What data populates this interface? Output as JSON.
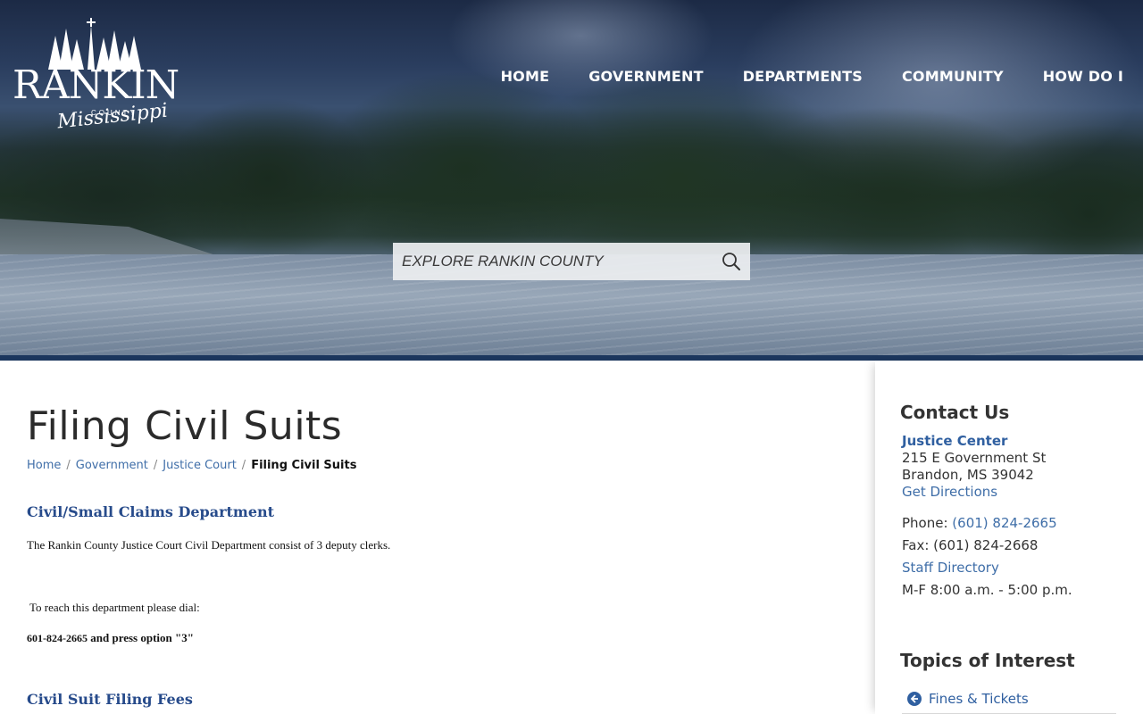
{
  "logo": {
    "word": "RANKIN",
    "county": "COUNTY",
    "state": "Mississippi"
  },
  "nav": {
    "items": [
      {
        "label": "HOME"
      },
      {
        "label": "GOVERNMENT"
      },
      {
        "label": "DEPARTMENTS"
      },
      {
        "label": "COMMUNITY"
      },
      {
        "label": "HOW DO I"
      }
    ]
  },
  "search": {
    "placeholder": "EXPLORE RANKIN COUNTY",
    "icon": "search-icon"
  },
  "page": {
    "title": "Filing Civil Suits",
    "breadcrumb": [
      {
        "label": "Home"
      },
      {
        "label": "Government"
      },
      {
        "label": "Justice Court"
      }
    ],
    "breadcrumb_current": "Filing Civil Suits",
    "sections": [
      {
        "heading": "Civil/Small Claims Department",
        "intro": "The Rankin County Justice Court Civil Department consist of 3 deputy clerks.",
        "reach": "To reach this department please dial:",
        "phone": "601-824-2665",
        "phone_suffix": " and press option \"3\""
      },
      {
        "heading": "Civil Suit Filing Fees"
      }
    ]
  },
  "sidebar": {
    "contact_title": "Contact Us",
    "location_name": "Justice Center",
    "address_line1": "215 E Government St",
    "address_line2": "Brandon, MS 39042",
    "directions_label": "Get Directions",
    "phone_label": "Phone: ",
    "phone_value": "(601) 824-2665",
    "fax_label": "Fax: (601) 824-2668",
    "staff_label": "Staff Directory",
    "hours": "M-F 8:00 a.m. - 5:00 p.m.",
    "topics_title": "Topics of Interest",
    "topics": [
      {
        "label": "Fines & Tickets",
        "icon": "arrow-circle-left-icon"
      }
    ]
  },
  "colors": {
    "brand_navy": "#1b365d",
    "link_blue": "#3f6ea8",
    "heading_blue": "#274b8b"
  }
}
